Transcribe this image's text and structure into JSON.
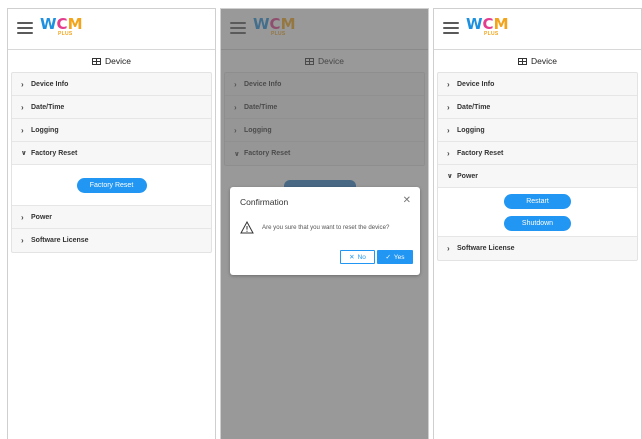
{
  "app": {
    "logo": {
      "w": "W",
      "c": "C",
      "m": "M",
      "plus": "PLUS"
    },
    "device_title": "Device"
  },
  "menu": {
    "device_info": "Device Info",
    "date_time": "Date/Time",
    "logging": "Logging",
    "factory_reset": "Factory Reset",
    "power": "Power",
    "software_license": "Software License"
  },
  "buttons": {
    "factory_reset": "Factory Reset",
    "restart": "Restart",
    "shutdown": "Shutdown"
  },
  "dialog": {
    "title": "Confirmation",
    "message": "Are you sure that you want to reset the device?",
    "no": "No",
    "yes": "Yes"
  },
  "colors": {
    "accent": "#2196f3",
    "logo_w": "#1e90e0",
    "logo_c": "#e33d8e",
    "logo_m": "#f2a51a"
  },
  "icons": [
    "hamburger-menu-icon",
    "table-icon",
    "chevron-right-icon",
    "chevron-down-icon",
    "warning-icon",
    "close-icon",
    "x-icon",
    "check-icon"
  ]
}
